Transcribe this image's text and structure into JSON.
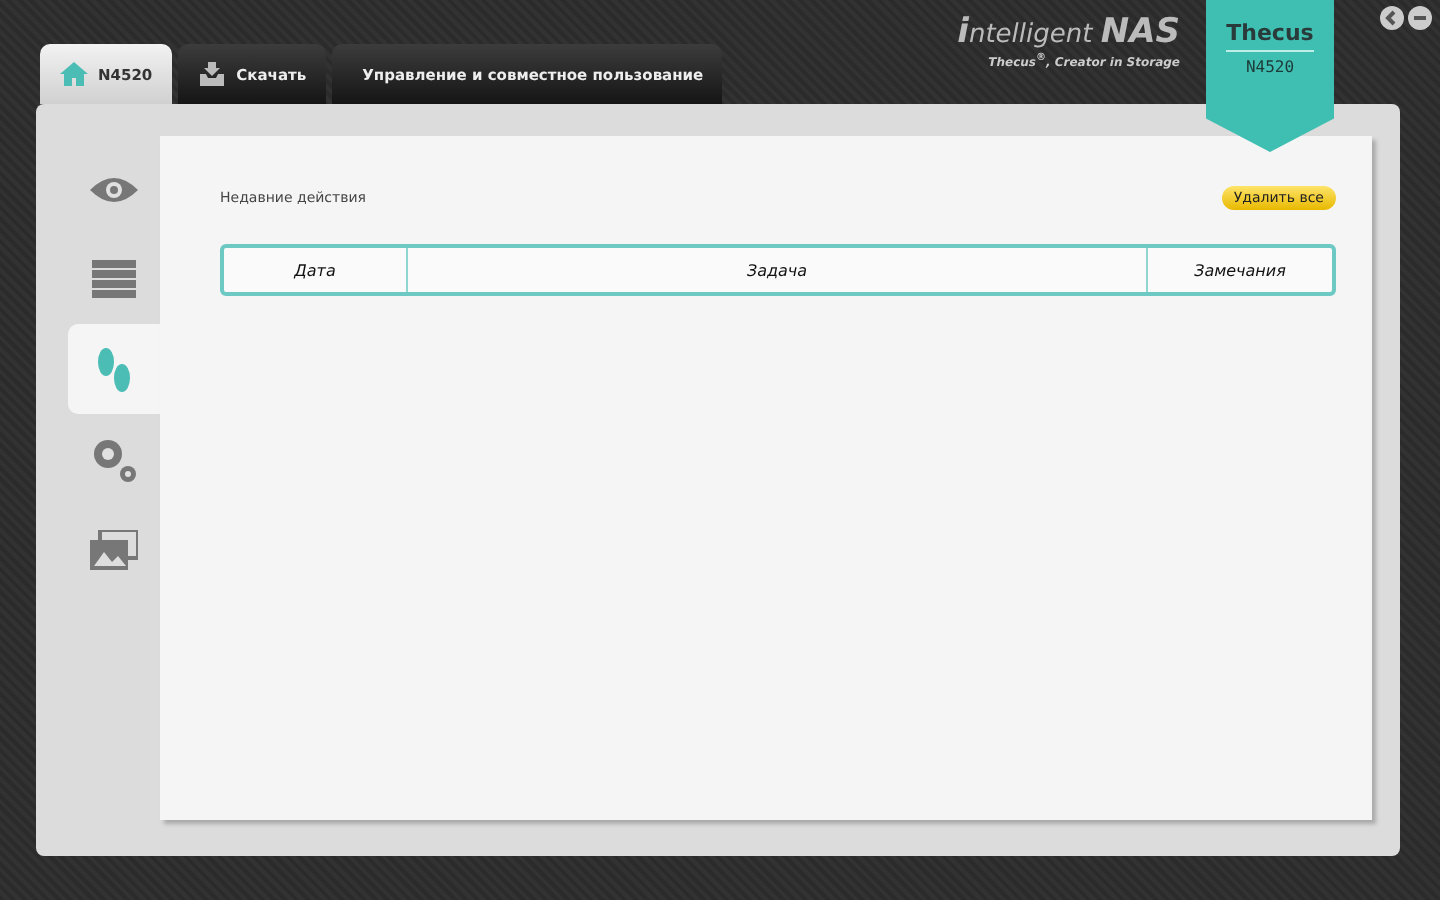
{
  "tabs": [
    {
      "label": "N4520",
      "selected": true
    },
    {
      "label": "Скачать",
      "selected": false
    },
    {
      "label": "Управление и совместное пользование",
      "selected": false
    }
  ],
  "logo": {
    "title_lead": "i",
    "title_rest": "ntelligent",
    "title_tail": "NAS",
    "tagline": "Thecus$^{®}$, Creator in Storage"
  },
  "badge": {
    "brand": "Thecus",
    "model": "N4520"
  },
  "sidebar": {
    "items": [
      {
        "selected": false
      },
      {
        "selected": false
      },
      {
        "selected": true
      },
      {
        "selected": false
      },
      {
        "selected": false
      }
    ]
  },
  "section": {
    "title": "Недавние действия",
    "button": "Удалить все"
  },
  "table": {
    "columns": [
      "Дата",
      "Задача",
      "Замечания"
    ]
  }
}
